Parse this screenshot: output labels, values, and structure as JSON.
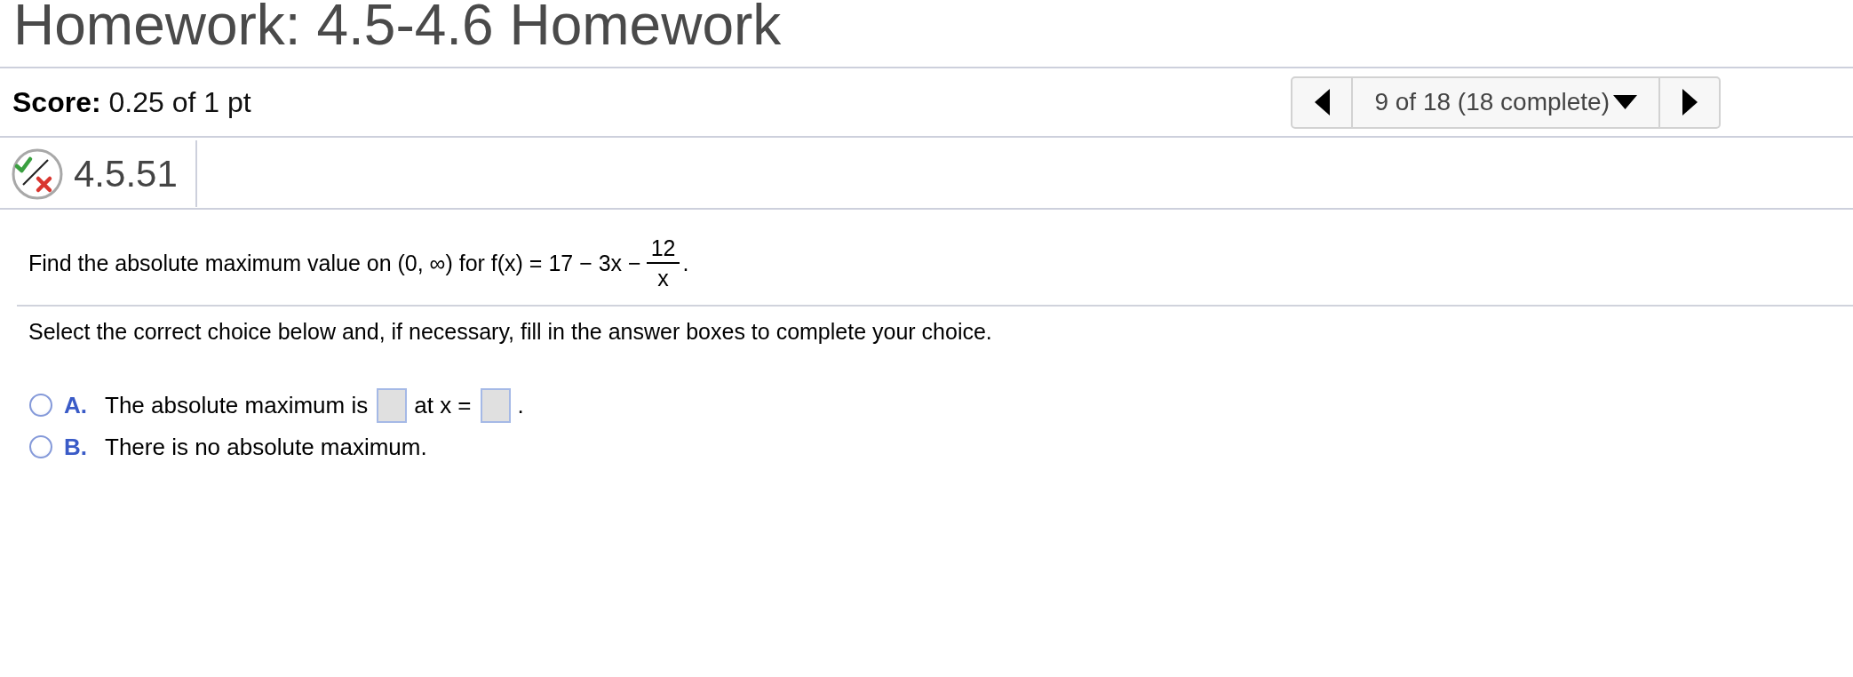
{
  "page": {
    "title": "Homework: 4.5-4.6 Homework"
  },
  "score": {
    "text": "**Score:** 0.25 of 1 pt"
  },
  "navigator": {
    "position": "9 of 18 (18 complete)"
  },
  "question": {
    "number": "4.5.51",
    "prompt": {
      "text": "Find the absolute maximum value on (0, ∞) for f(x) = 17 − 3x −",
      "fraction": {
        "numerator": "12",
        "denominator": "x"
      },
      "end": "."
    },
    "instruction": "Select the correct choice below and, if necessary, fill in the answer boxes to complete your choice.",
    "choices": [
      {
        "letter": "A.",
        "selected": false,
        "parts": [
          {
            "kind": "text",
            "text": "The absolute maximum is"
          },
          {
            "kind": "blank"
          },
          {
            "kind": "text",
            "text": "at x ="
          },
          {
            "kind": "blank"
          },
          {
            "kind": "text",
            "text": "."
          }
        ]
      },
      {
        "letter": "B.",
        "selected": false,
        "parts": [
          {
            "kind": "text",
            "text": "There is no absolute maximum."
          }
        ]
      }
    ]
  }
}
